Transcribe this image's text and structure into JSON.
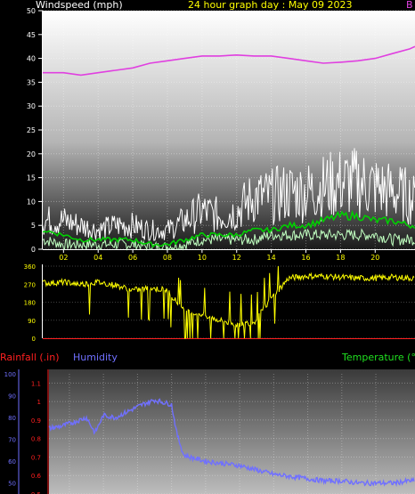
{
  "header": {
    "windspeed_label": "Windspeed (mph)",
    "title": "24 hour graph day : May 09 2023",
    "pressure_fragment": "B"
  },
  "lower_header": {
    "rainfall_label": "Rainfall (.in)",
    "humidity_label": "Humidity",
    "temperature_label": "Temperature (°F)"
  },
  "colors": {
    "background": "#000000",
    "windspeed_label": "#ffffff",
    "title": "#ffff00",
    "pressure": "#e040e0",
    "gust": "#ffffff",
    "average": "#00d000",
    "light_wind": "#c0ffc0",
    "direction": "#ffff00",
    "rainfall": "#ff2020",
    "humidity": "#7070ff",
    "temperature": "#20e020"
  },
  "chart_data": [
    {
      "type": "line",
      "title": "Windspeed (mph)",
      "ylim": [
        0,
        50
      ],
      "yticks": [
        0,
        5,
        10,
        15,
        20,
        25,
        30,
        35,
        40,
        45,
        50
      ],
      "xlim": [
        0.8,
        22.3
      ],
      "xticks": [
        "02",
        "04",
        "06",
        "08",
        "10",
        "12",
        "14",
        "16",
        "18",
        "20"
      ],
      "grid": true,
      "series": [
        {
          "name": "pressure",
          "x": [
            0.8,
            2,
            3,
            4,
            5,
            6,
            7,
            8,
            9,
            10,
            11,
            12,
            13,
            14,
            15,
            16,
            17,
            18,
            19,
            20,
            21,
            22,
            22.3
          ],
          "values": [
            37,
            37,
            36.5,
            37,
            37.5,
            38,
            39,
            39.5,
            40,
            40.5,
            40.5,
            40.7,
            40.5,
            40.5,
            40,
            39.5,
            39,
            39.2,
            39.5,
            40,
            41,
            42,
            42.5
          ]
        },
        {
          "name": "gust",
          "x": [
            0.8,
            2,
            3,
            4,
            5,
            6,
            7,
            8,
            9,
            10,
            11,
            12,
            13,
            14,
            15,
            16,
            17,
            18,
            19,
            20,
            21,
            22,
            22.3
          ],
          "values": [
            6,
            6,
            5,
            4,
            5,
            5,
            4,
            4,
            6,
            8,
            7,
            8,
            11,
            11,
            12,
            12,
            13,
            14,
            14,
            13,
            12,
            11,
            10
          ]
        },
        {
          "name": "average",
          "x": [
            0.8,
            2,
            3,
            4,
            5,
            6,
            7,
            8,
            9,
            10,
            11,
            12,
            13,
            14,
            15,
            16,
            17,
            18,
            19,
            20,
            21,
            22,
            22.3
          ],
          "values": [
            4,
            3,
            2,
            2,
            2,
            2,
            1,
            1,
            2,
            3,
            3,
            3,
            4,
            4,
            5,
            5,
            6,
            7,
            7,
            6,
            6,
            5,
            5
          ]
        },
        {
          "name": "light",
          "x": [
            0.8,
            2,
            3,
            4,
            5,
            6,
            7,
            8,
            9,
            10,
            11,
            12,
            13,
            14,
            15,
            16,
            17,
            18,
            19,
            20,
            21,
            22,
            22.3
          ],
          "values": [
            2,
            1,
            1,
            1,
            1,
            1,
            0.5,
            0.5,
            1,
            2,
            2,
            2,
            2,
            3,
            3,
            3,
            3,
            3,
            3,
            3,
            2,
            2,
            2
          ]
        }
      ]
    },
    {
      "type": "line",
      "title": "Wind direction",
      "ylim": [
        0,
        360
      ],
      "yticks": [
        0,
        90,
        180,
        270,
        360
      ],
      "xlim": [
        0.8,
        22.3
      ],
      "grid": true,
      "series": [
        {
          "name": "direction",
          "x": [
            0.8,
            1,
            2,
            3,
            4,
            5,
            6,
            7,
            8,
            9,
            10,
            11,
            12,
            13,
            14,
            15,
            16,
            17,
            18,
            19,
            20,
            21,
            22,
            22.3
          ],
          "values": [
            280,
            275,
            280,
            270,
            280,
            265,
            240,
            250,
            240,
            130,
            120,
            90,
            70,
            80,
            200,
            300,
            310,
            310,
            305,
            300,
            300,
            305,
            300,
            300
          ]
        }
      ]
    },
    {
      "type": "line",
      "title": "",
      "ylim": [
        30,
        100
      ],
      "yticks": [
        50,
        60,
        70,
        80,
        90,
        100
      ],
      "y2lim": [
        0.5,
        1.2
      ],
      "y2ticks": [
        0.5,
        0.6,
        0.7,
        0.8,
        0.9,
        1,
        1.1
      ],
      "grid": true,
      "series": [
        {
          "name": "humidity",
          "x": [
            0.8,
            1.5,
            2.3,
            3,
            3.5,
            4,
            4.7,
            5.5,
            6.3,
            7,
            7.5,
            8,
            8.3,
            8.7,
            9,
            9.5,
            10,
            11,
            12,
            13,
            14,
            15,
            16,
            17,
            18,
            19,
            20,
            21,
            22,
            22.3
          ],
          "values": [
            75,
            76,
            78,
            80,
            73,
            81,
            80,
            83,
            86,
            88,
            87,
            86,
            73,
            63,
            62,
            61,
            60,
            59,
            58,
            56,
            54,
            53,
            52,
            51,
            51,
            50,
            50,
            50,
            51,
            51
          ]
        }
      ]
    }
  ]
}
